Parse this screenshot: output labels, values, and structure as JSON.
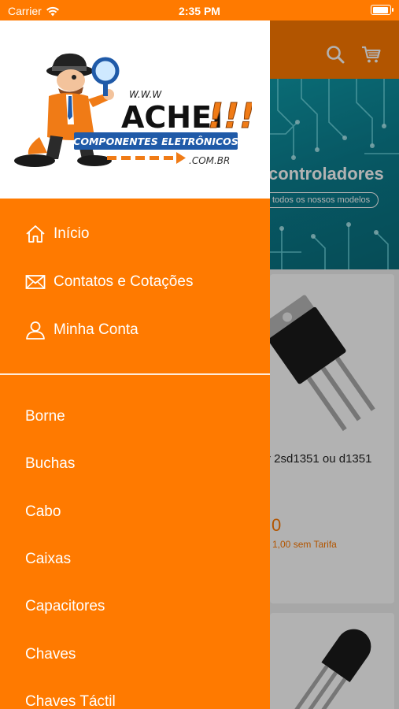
{
  "status_bar": {
    "carrier": "Carrier",
    "time": "2:35 PM"
  },
  "logo": {
    "www": "W.W.W",
    "brand": "ACHEI",
    "exclaims": "!!!",
    "tagline": "COMPONENTES ELETRÔNICOS",
    "domain": ".COM.BR"
  },
  "drawer": {
    "primary": [
      {
        "label": "Início",
        "icon": "home-icon"
      },
      {
        "label": "Contatos e Cotações",
        "icon": "envelope-icon"
      },
      {
        "label": "Minha Conta",
        "icon": "user-icon"
      }
    ],
    "categories": [
      {
        "label": "Borne"
      },
      {
        "label": "Buchas"
      },
      {
        "label": "Cabo"
      },
      {
        "label": "Caixas"
      },
      {
        "label": "Capacitores"
      },
      {
        "label": "Chaves"
      },
      {
        "label": "Chaves Táctil"
      }
    ]
  },
  "background_app": {
    "banner_headline": "controladores",
    "banner_pill": "todos os nossos modelos",
    "product_name": "r 2sd1351 ou d1351",
    "product_price": "0",
    "product_tarifa": "1,00 sem Tarifa",
    "icons": [
      "search-icon",
      "cart-icon"
    ]
  },
  "colors": {
    "accent": "#FF7A00",
    "banner": "#0b8494",
    "logo_blue": "#1f5aa8"
  }
}
